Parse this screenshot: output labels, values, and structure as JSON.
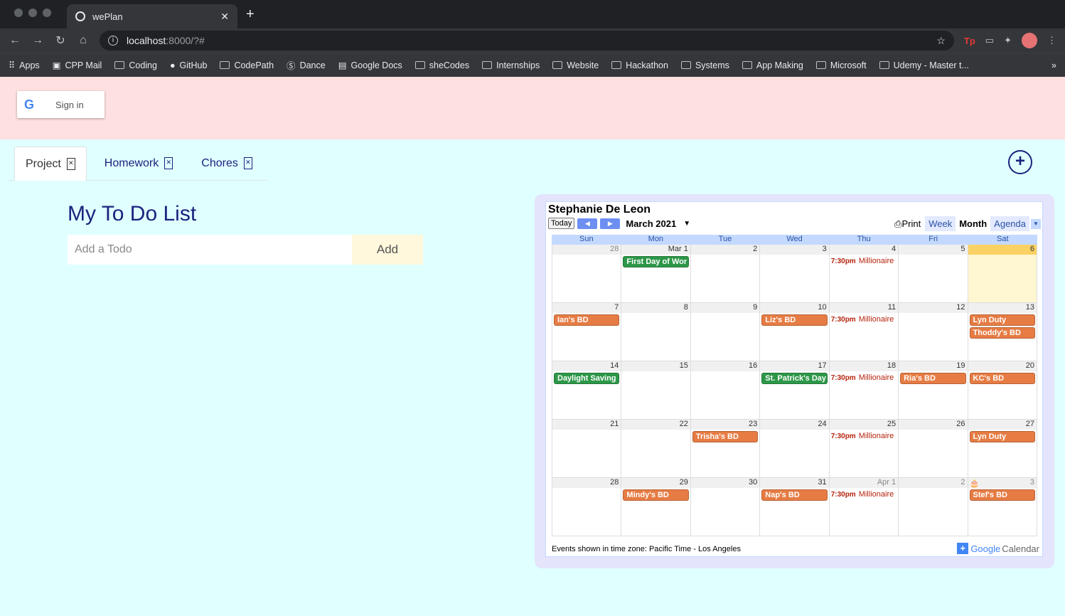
{
  "browser": {
    "tab_title": "wePlan",
    "url_host": "localhost",
    "url_path": ":8000/?#",
    "bookmarks": [
      "Apps",
      "CPP Mail",
      "Coding",
      "GitHub",
      "CodePath",
      "Dance",
      "Google Docs",
      "sheCodes",
      "Internships",
      "Website",
      "Hackathon",
      "Systems",
      "App Making",
      "Microsoft",
      "Udemy - Master t..."
    ]
  },
  "header": {
    "signin_label": "Sign in"
  },
  "tabs": [
    {
      "label": "Project"
    },
    {
      "label": "Homework"
    },
    {
      "label": "Chores"
    }
  ],
  "todo": {
    "title": "My To Do List",
    "placeholder": "Add a Todo",
    "add_label": "Add"
  },
  "calendar": {
    "owner": "Stephanie De Leon",
    "today_label": "Today",
    "month_label": "March 2021",
    "print_label": "Print",
    "views": [
      "Week",
      "Month",
      "Agenda"
    ],
    "selected_view": "Month",
    "days_of_week": [
      "Sun",
      "Mon",
      "Tue",
      "Wed",
      "Thu",
      "Fri",
      "Sat"
    ],
    "footer": "Events shown in time zone: Pacific Time - Los Angeles",
    "brand_google": "Google",
    "brand_calendar": "Calendar",
    "weeks": [
      [
        {
          "n": "28",
          "other": true,
          "events": []
        },
        {
          "n": "Mar 1",
          "events": [
            {
              "t": "First Day of Wor",
              "c": "green"
            }
          ]
        },
        {
          "n": "2",
          "events": []
        },
        {
          "n": "3",
          "events": []
        },
        {
          "n": "4",
          "events": [
            {
              "time": "7:30pm",
              "t": "Millionaire"
            }
          ]
        },
        {
          "n": "5",
          "events": []
        },
        {
          "n": "6",
          "today": true,
          "events": []
        }
      ],
      [
        {
          "n": "7",
          "events": [
            {
              "t": "Ian's BD",
              "c": "orange"
            }
          ]
        },
        {
          "n": "8",
          "events": []
        },
        {
          "n": "9",
          "events": []
        },
        {
          "n": "10",
          "events": [
            {
              "t": "Liz's BD",
              "c": "orange"
            }
          ]
        },
        {
          "n": "11",
          "events": [
            {
              "time": "7:30pm",
              "t": "Millionaire"
            }
          ]
        },
        {
          "n": "12",
          "events": []
        },
        {
          "n": "13",
          "events": [
            {
              "t": "Lyn Duty",
              "c": "orange"
            },
            {
              "t": "Thoddy's BD",
              "c": "orange"
            }
          ]
        }
      ],
      [
        {
          "n": "14",
          "events": [
            {
              "t": "Daylight Saving",
              "c": "green"
            }
          ]
        },
        {
          "n": "15",
          "events": []
        },
        {
          "n": "16",
          "events": []
        },
        {
          "n": "17",
          "events": [
            {
              "t": "St. Patrick's Day",
              "c": "green"
            }
          ]
        },
        {
          "n": "18",
          "events": [
            {
              "time": "7:30pm",
              "t": "Millionaire"
            }
          ]
        },
        {
          "n": "19",
          "events": [
            {
              "t": "Ria's BD",
              "c": "orange"
            }
          ]
        },
        {
          "n": "20",
          "events": [
            {
              "t": "KC's BD",
              "c": "orange"
            }
          ]
        }
      ],
      [
        {
          "n": "21",
          "events": []
        },
        {
          "n": "22",
          "events": []
        },
        {
          "n": "23",
          "events": [
            {
              "t": "Trisha's BD",
              "c": "orange"
            }
          ]
        },
        {
          "n": "24",
          "events": []
        },
        {
          "n": "25",
          "events": [
            {
              "time": "7:30pm",
              "t": "Millionaire"
            }
          ]
        },
        {
          "n": "26",
          "events": []
        },
        {
          "n": "27",
          "events": [
            {
              "t": "Lyn Duty",
              "c": "orange"
            }
          ]
        }
      ],
      [
        {
          "n": "28",
          "events": []
        },
        {
          "n": "29",
          "events": [
            {
              "t": "Mindy's BD",
              "c": "orange"
            }
          ]
        },
        {
          "n": "30",
          "events": []
        },
        {
          "n": "31",
          "events": [
            {
              "t": "Nap's BD",
              "c": "orange"
            }
          ]
        },
        {
          "n": "Apr 1",
          "other": true,
          "events": [
            {
              "time": "7:30pm",
              "t": "Millionaire"
            }
          ]
        },
        {
          "n": "2",
          "other": true,
          "events": []
        },
        {
          "n": "3",
          "other": true,
          "cake": true,
          "events": [
            {
              "t": "Stef's BD",
              "c": "orange"
            }
          ]
        }
      ]
    ]
  }
}
